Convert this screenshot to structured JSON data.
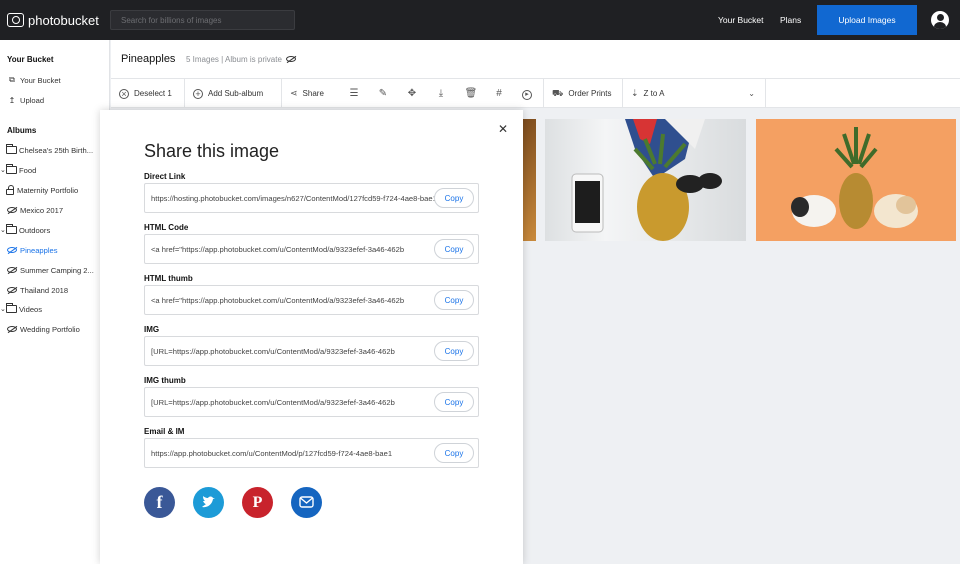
{
  "topbar": {
    "logo_text": "photobucket",
    "search_placeholder": "Search for billions of images",
    "your_bucket": "Your Bucket",
    "plans": "Plans",
    "upload": "Upload Images"
  },
  "sidebar": {
    "bucket_heading": "Your Bucket",
    "bucket_items": [
      {
        "label": "Your Bucket",
        "icon": "photos-icon"
      },
      {
        "label": "Upload",
        "icon": "upload-icon"
      }
    ],
    "albums_heading": "Albums",
    "albums": [
      {
        "label": "Chelsea's 25th Birth...",
        "icon": "folder-icon",
        "prefix": ""
      },
      {
        "label": "Food",
        "icon": "folder-icon",
        "prefix": "›"
      },
      {
        "label": "Maternity Portfolio",
        "icon": "lock-icon",
        "prefix": ""
      },
      {
        "label": "Mexico 2017",
        "icon": "private-eye-icon",
        "prefix": ""
      },
      {
        "label": "Outdoors",
        "icon": "folder-icon",
        "prefix": "›"
      },
      {
        "label": "Pineapples",
        "icon": "private-eye-icon",
        "prefix": "",
        "active": true
      },
      {
        "label": "Summer Camping 2...",
        "icon": "private-eye-icon",
        "prefix": ""
      },
      {
        "label": "Thailand 2018",
        "icon": "private-eye-icon",
        "prefix": ""
      },
      {
        "label": "Videos",
        "icon": "folder-icon",
        "prefix": "›"
      },
      {
        "label": "Wedding Portfolio",
        "icon": "private-eye-icon",
        "prefix": ""
      }
    ]
  },
  "album": {
    "title": "Pineapples",
    "meta": "5 Images | Album is private"
  },
  "toolbar": {
    "deselect": "Deselect 1",
    "add_subalbum": "Add Sub-album",
    "share": "Share",
    "order_prints": "Order Prints",
    "sort": "Z to A"
  },
  "modal": {
    "title": "Share this image",
    "copy_label": "Copy",
    "fields": [
      {
        "label": "Direct Link",
        "value": "https://hosting.photobucket.com/images/n627/ContentMod/127fcd59-f724-4ae8-bae1"
      },
      {
        "label": "HTML Code",
        "value": "<a href=\"https://app.photobucket.com/u/ContentMod/a/9323efef-3a46-462b"
      },
      {
        "label": "HTML thumb",
        "value": "<a href=\"https://app.photobucket.com/u/ContentMod/a/9323efef-3a46-462b"
      },
      {
        "label": "IMG",
        "value": "[URL=https://app.photobucket.com/u/ContentMod/a/9323efef-3a46-462b"
      },
      {
        "label": "IMG thumb",
        "value": "[URL=https://app.photobucket.com/u/ContentMod/a/9323efef-3a46-462b"
      },
      {
        "label": "Email & IM",
        "value": "https://app.photobucket.com/u/ContentMod/p/127fcd59-f724-4ae8-bae1"
      }
    ],
    "social": [
      "facebook-icon",
      "twitter-icon",
      "pinterest-icon",
      "email-icon"
    ]
  },
  "colors": {
    "topbar": "#1f2023",
    "accent": "#1168d1",
    "facebook": "#3a5897",
    "twitter": "#1d9bd7",
    "pinterest": "#c8232c",
    "email": "#1565c0"
  }
}
